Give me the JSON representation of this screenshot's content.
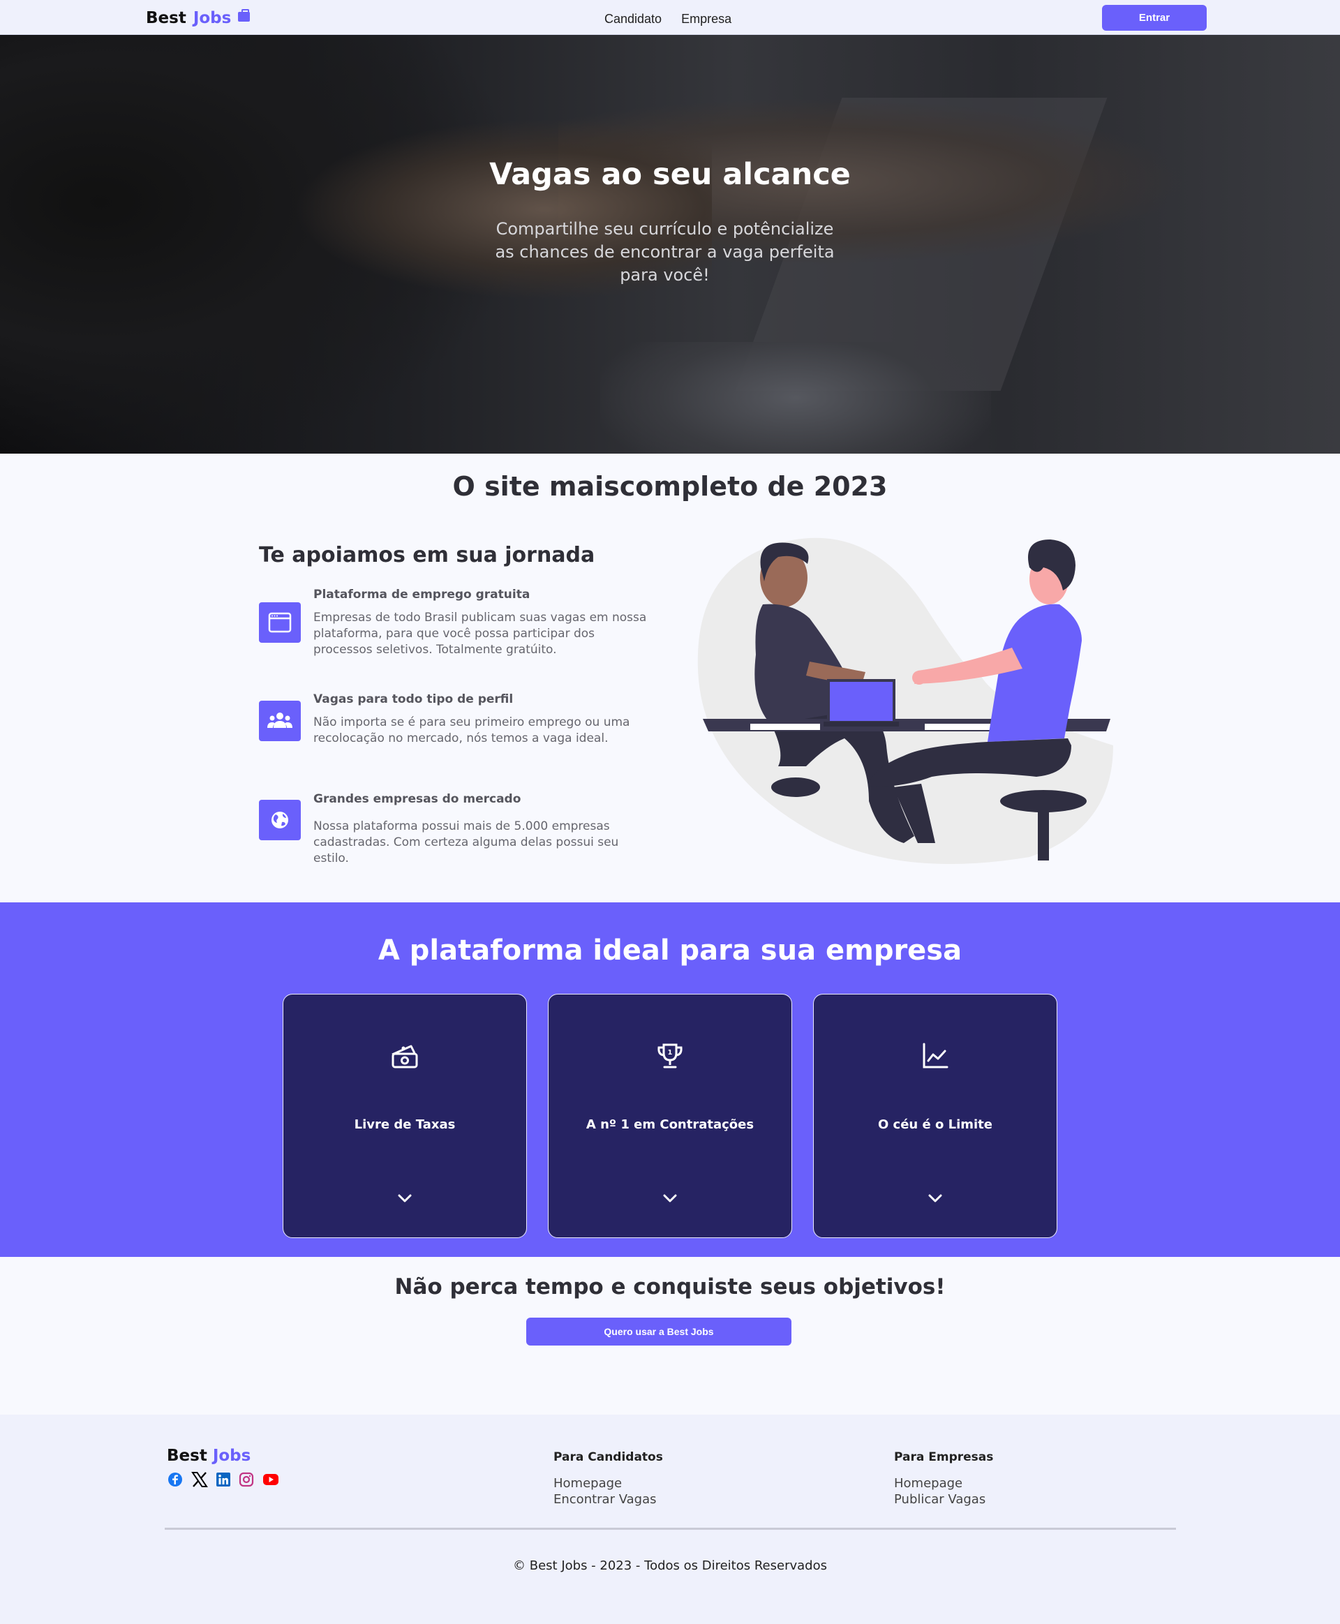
{
  "nav": {
    "brand_best": "Best",
    "brand_jobs": "Jobs",
    "links": [
      "Candidato",
      "Empresa"
    ],
    "enter_label": "Entrar"
  },
  "hero": {
    "title": "Vagas ao seu alcance",
    "subtitle": "Compartilhe seu currículo e potêncialize as chances de encontrar a vaga perfeita para você!"
  },
  "about": {
    "title": "O site maiscompleto de 2023",
    "subtitle": "Te apoiamos em sua jornada",
    "features": [
      {
        "icon": "browser-window-icon",
        "title": "Plataforma de emprego gratuita",
        "text": "Empresas de todo Brasil publicam suas vagas em nossa plataforma, para que você possa participar dos processos seletivos. Totalmente gratúito."
      },
      {
        "icon": "users-group-icon",
        "title": "Vagas para todo tipo de perfil",
        "text": "Não importa se é para seu primeiro emprego ou uma recolocação no mercado, nós temos a vaga ideal."
      },
      {
        "icon": "globe-icon",
        "title": "Grandes empresas do mercado",
        "text": "Nossa plataforma possui mais de 5.000 empresas cadastradas. Com certeza alguma delas possui seu estilo."
      }
    ]
  },
  "platform": {
    "title": "A plataforma ideal para sua empresa",
    "cards": [
      {
        "icon": "money-bill-icon",
        "label": "Livre de Taxas"
      },
      {
        "icon": "trophy-icon",
        "label": "A nº 1 em Contratações"
      },
      {
        "icon": "chart-line-icon",
        "label": "O céu é o Limite"
      }
    ]
  },
  "cta": {
    "title": "Não perca tempo e conquiste seus objetivos!",
    "button": "Quero usar a Best Jobs"
  },
  "footer": {
    "brand_best": "Best",
    "brand_jobs": "Jobs",
    "social": [
      "facebook-icon",
      "x-icon",
      "linkedin-icon",
      "instagram-icon",
      "youtube-icon"
    ],
    "candidates": {
      "heading": "Para Candidatos",
      "links": [
        "Homepage",
        "Encontrar Vagas"
      ]
    },
    "companies": {
      "heading": "Para Empresas",
      "links": [
        "Homepage",
        "Publicar Vagas"
      ]
    },
    "copyright": "© Best Jobs - 2023 - Todos os Direitos Reservados"
  },
  "colors": {
    "accent": "#6a60fb",
    "card_bg": "#262363",
    "page_bg": "#f8f9fe",
    "footer_bg": "#eff1fc"
  }
}
